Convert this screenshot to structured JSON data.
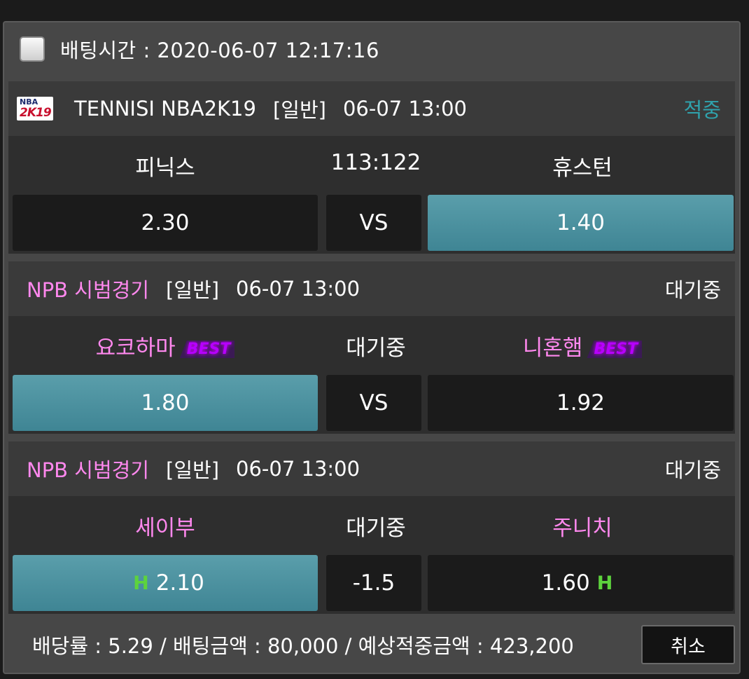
{
  "header": {
    "bet_time": "배팅시간 : 2020-06-07 12:17:16"
  },
  "games": [
    {
      "league": "TENNISI NBA2K19",
      "logo_text": {
        "top": "NBA",
        "bottom": "2K19"
      },
      "type": "[일반]",
      "time": "06-07 13:00",
      "status": "적중",
      "home": "피닉스",
      "center": "113:122",
      "away": "휴스턴",
      "odds_home": "2.30",
      "odds_mid": "VS",
      "odds_away": "1.40"
    },
    {
      "league": "NPB 시범경기",
      "type": "[일반]",
      "time": "06-07 13:00",
      "status": "대기중",
      "home": "요코하마",
      "center": "대기중",
      "away": "니혼햄",
      "best_label": "BEST",
      "odds_home": "1.80",
      "odds_mid": "VS",
      "odds_away": "1.92"
    },
    {
      "league": "NPB 시범경기",
      "type": "[일반]",
      "time": "06-07 13:00",
      "status": "대기중",
      "home": "세이부",
      "center": "대기중",
      "away": "주니치",
      "handicap_mark": "H",
      "odds_home": "2.10",
      "odds_mid": "-1.5",
      "odds_away": "1.60"
    }
  ],
  "footer": {
    "summary": "배당률 : 5.29 / 배팅금액 : 80,000 / 예상적중금액 : 423,200",
    "cancel_label": "취소"
  },
  "colors": {
    "accent_teal": "#2fa3ad",
    "selected_cell": "#4a8f9d",
    "pink_text": "#ff88ee",
    "best_purple": "#b700ff",
    "handicap_green": "#5dd33d"
  }
}
